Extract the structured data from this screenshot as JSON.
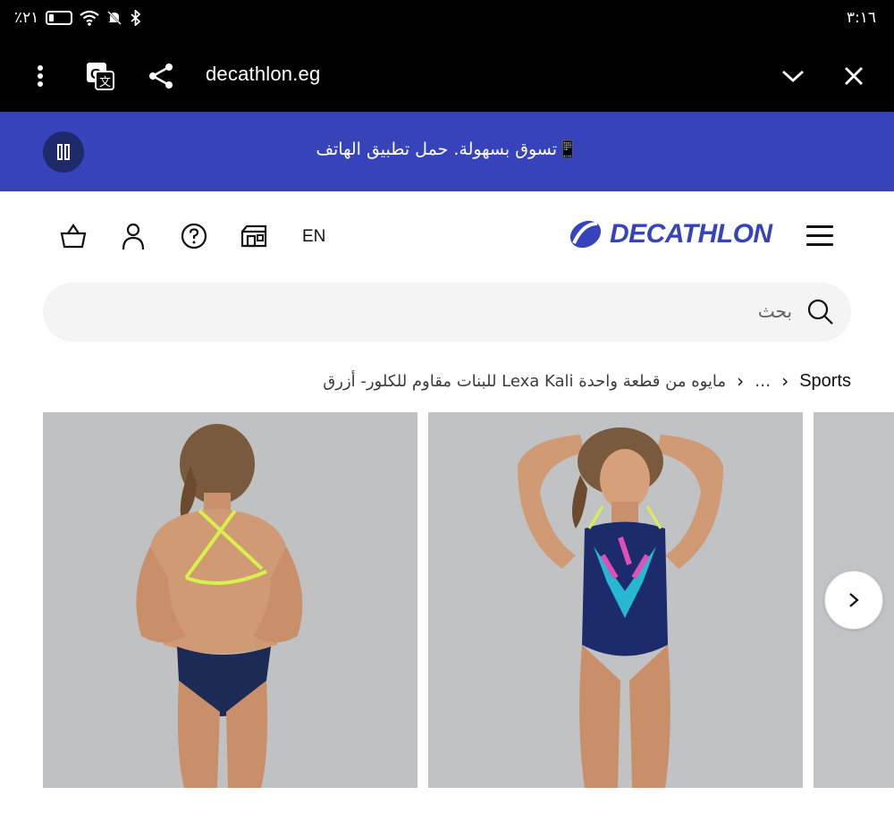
{
  "status_bar": {
    "battery_text": "٪٢١",
    "time": "٣:١٦"
  },
  "browser": {
    "url": "decathlon.eg",
    "icons": [
      "more-vert-icon",
      "translate-icon",
      "share-icon",
      "chevron-down-icon",
      "close-icon"
    ]
  },
  "promo": {
    "text": "📱تسوق بسهولة. حمل تطبيق الهاتف",
    "pause_icon": "pause-icon",
    "bg_color": "#3643ba"
  },
  "header": {
    "lang_label": "EN",
    "logo_text": "DECATHLON",
    "icons": [
      "basket-icon",
      "user-icon",
      "help-icon",
      "store-icon",
      "hamburger-menu-icon"
    ]
  },
  "search": {
    "placeholder": "بحث"
  },
  "breadcrumb": {
    "items": [
      "Sports",
      "...",
      "مايوه من قطعة واحدة Lexa Kali للبنات مقاوم للكلور- أزرق"
    ]
  },
  "gallery": {
    "images": [
      "swimsuit-back-view-photo",
      "swimsuit-front-view-photo",
      "swimsuit-partial-photo"
    ],
    "next_icon": "chevron-right-icon"
  },
  "colors": {
    "brand": "#3643ba",
    "background": "#ffffff",
    "search_bg": "#f4f4f5"
  }
}
